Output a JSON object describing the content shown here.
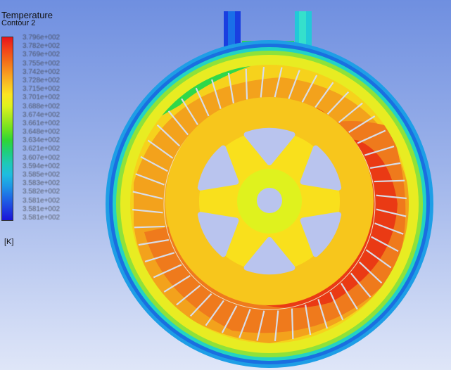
{
  "legend": {
    "title": "Temperature",
    "subtitle": "Contour 2",
    "unit": "[K]",
    "max_label": "3.796e+002",
    "min_label": "3.581e+002",
    "colors": [
      "#e8141a",
      "#f2401a",
      "#f26a1a",
      "#f79420",
      "#f9bd24",
      "#fbe422",
      "#dff21e",
      "#a9e81e",
      "#6fe21e",
      "#2fd635",
      "#1ecf7a",
      "#1ec9b6",
      "#1ebde0",
      "#1e98e6",
      "#1e6ae6",
      "#1e3ee0",
      "#1a14d8"
    ],
    "ticks": [
      "3.796e+002",
      "3.782e+002",
      "3.769e+002",
      "3.755e+002",
      "3.742e+002",
      "3.728e+002",
      "3.715e+002",
      "3.701e+002",
      "3.688e+002",
      "3.674e+002",
      "3.661e+002",
      "3.648e+002",
      "3.634e+002",
      "3.621e+002",
      "3.607e+002",
      "3.594e+002",
      "3.585e+002",
      "3.583e+002",
      "3.582e+002",
      "3.581e+002",
      "3.581e+002",
      "3.581e+002"
    ]
  },
  "plot": {
    "colors": {
      "outer_blue": "#1a6fe0",
      "cyan": "#22d3c4",
      "green": "#3fd32a",
      "yellow_green": "#c8ea1e",
      "yellow": "#f6e11c",
      "yellow_orange": "#f7c61c",
      "orange": "#f3a21c",
      "dark_orange": "#ef7a1c",
      "red": "#ea3a14",
      "cutout": "#b9c4ee",
      "slot": "#d8dde8"
    }
  }
}
